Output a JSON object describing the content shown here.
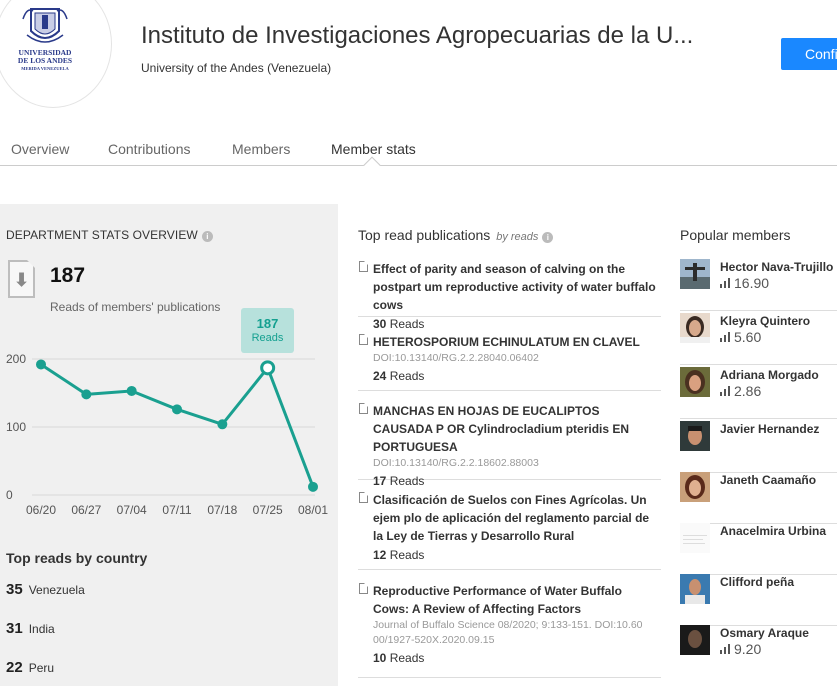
{
  "header": {
    "logo_text_line1": "UNIVERSIDAD",
    "logo_text_line2": "DE LOS ANDES",
    "logo_text_line3": "MERIDA VENEZUELA",
    "title": "Instituto de Investigaciones Agropecuarias de la U...",
    "subtitle": "University of the Andes (Venezuela)",
    "confirm_label": "Confi"
  },
  "tabs": [
    {
      "label": "Overview"
    },
    {
      "label": "Contributions"
    },
    {
      "label": "Members"
    },
    {
      "label": "Member stats"
    }
  ],
  "department_stats": {
    "title": "DEPARTMENT STATS OVERVIEW",
    "info_icon": "info-icon",
    "reads_total": "187",
    "reads_label": "Reads of members' publications",
    "tooltip_value": "187",
    "tooltip_label": "Reads"
  },
  "chart_data": {
    "type": "line",
    "x": [
      "06/20",
      "06/27",
      "07/04",
      "07/11",
      "07/18",
      "07/25",
      "08/01"
    ],
    "series": [
      {
        "values": [
          192,
          148,
          153,
          126,
          104,
          187,
          12
        ]
      }
    ],
    "y_ticks": [
      0,
      100,
      200
    ],
    "ylim": [
      0,
      200
    ],
    "highlight_index": 5,
    "color": "#1aa090",
    "grid": true
  },
  "top_countries": {
    "title": "Top reads by country",
    "items": [
      {
        "count": "35",
        "name": "Venezuela"
      },
      {
        "count": "31",
        "name": "India"
      },
      {
        "count": "22",
        "name": "Peru"
      }
    ]
  },
  "publications": {
    "title": "Top read publications",
    "by": "by reads",
    "items": [
      {
        "title": "Effect of parity and season of calving on the postpart um reproductive activity of water buffalo cows",
        "meta": "",
        "reads_count": "30",
        "reads_label": "Reads"
      },
      {
        "title": "HETEROSPORIUM ECHINULATUM EN CLAVEL",
        "meta": "DOI:10.13140/RG.2.2.28040.06402",
        "reads_count": "24",
        "reads_label": "Reads"
      },
      {
        "title": "MANCHAS EN HOJAS DE EUCALIPTOS CAUSADA P OR Cylindrocladium pteridis EN PORTUGUESA",
        "meta": "DOI:10.13140/RG.2.2.18602.88003",
        "reads_count": "17",
        "reads_label": "Reads"
      },
      {
        "title": "Clasificación de Suelos con Fines Agrícolas. Un ejem plo de aplicación del reglamento parcial de la Ley de Tierras y Desarrollo Rural",
        "meta": "",
        "reads_count": "12",
        "reads_label": "Reads"
      },
      {
        "title": "Reproductive Performance of Water Buffalo Cows: A Review of Affecting Factors",
        "meta": "Journal of Buffalo Science 08/2020; 9:133-151. DOI:10.60 00/1927-520X.2020.09.15",
        "reads_count": "10",
        "reads_label": "Reads"
      }
    ]
  },
  "popular_members": {
    "title": "Popular members",
    "items": [
      {
        "name": "Hector Nava-Trujillo",
        "score": "16.90"
      },
      {
        "name": "Kleyra Quintero",
        "score": "5.60"
      },
      {
        "name": "Adriana Morgado",
        "score": "2.86"
      },
      {
        "name": "Javier Hernandez",
        "score": ""
      },
      {
        "name": "Janeth Caamaño",
        "score": ""
      },
      {
        "name": "Anacelmira Urbina",
        "score": ""
      },
      {
        "name": "Clifford peña",
        "score": ""
      },
      {
        "name": "Osmary Araque",
        "score": "9.20"
      }
    ]
  }
}
